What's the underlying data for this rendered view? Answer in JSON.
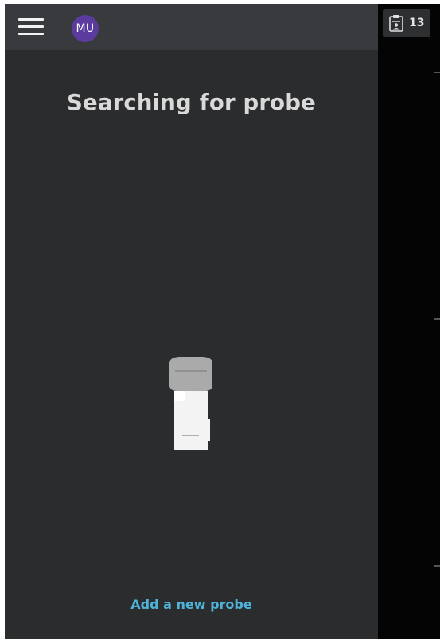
{
  "header": {
    "menu_icon": "hamburger-menu-icon",
    "avatar_initials": "MU",
    "avatar_color": "#5b3c9e"
  },
  "main": {
    "title": "Searching for probe",
    "probe_icon": "ultrasound-probe-icon",
    "add_probe_label": "Add a new probe",
    "link_color": "#4fb3d9"
  },
  "side": {
    "patient_icon": "clipboard-patient-icon",
    "patient_count": "13"
  }
}
